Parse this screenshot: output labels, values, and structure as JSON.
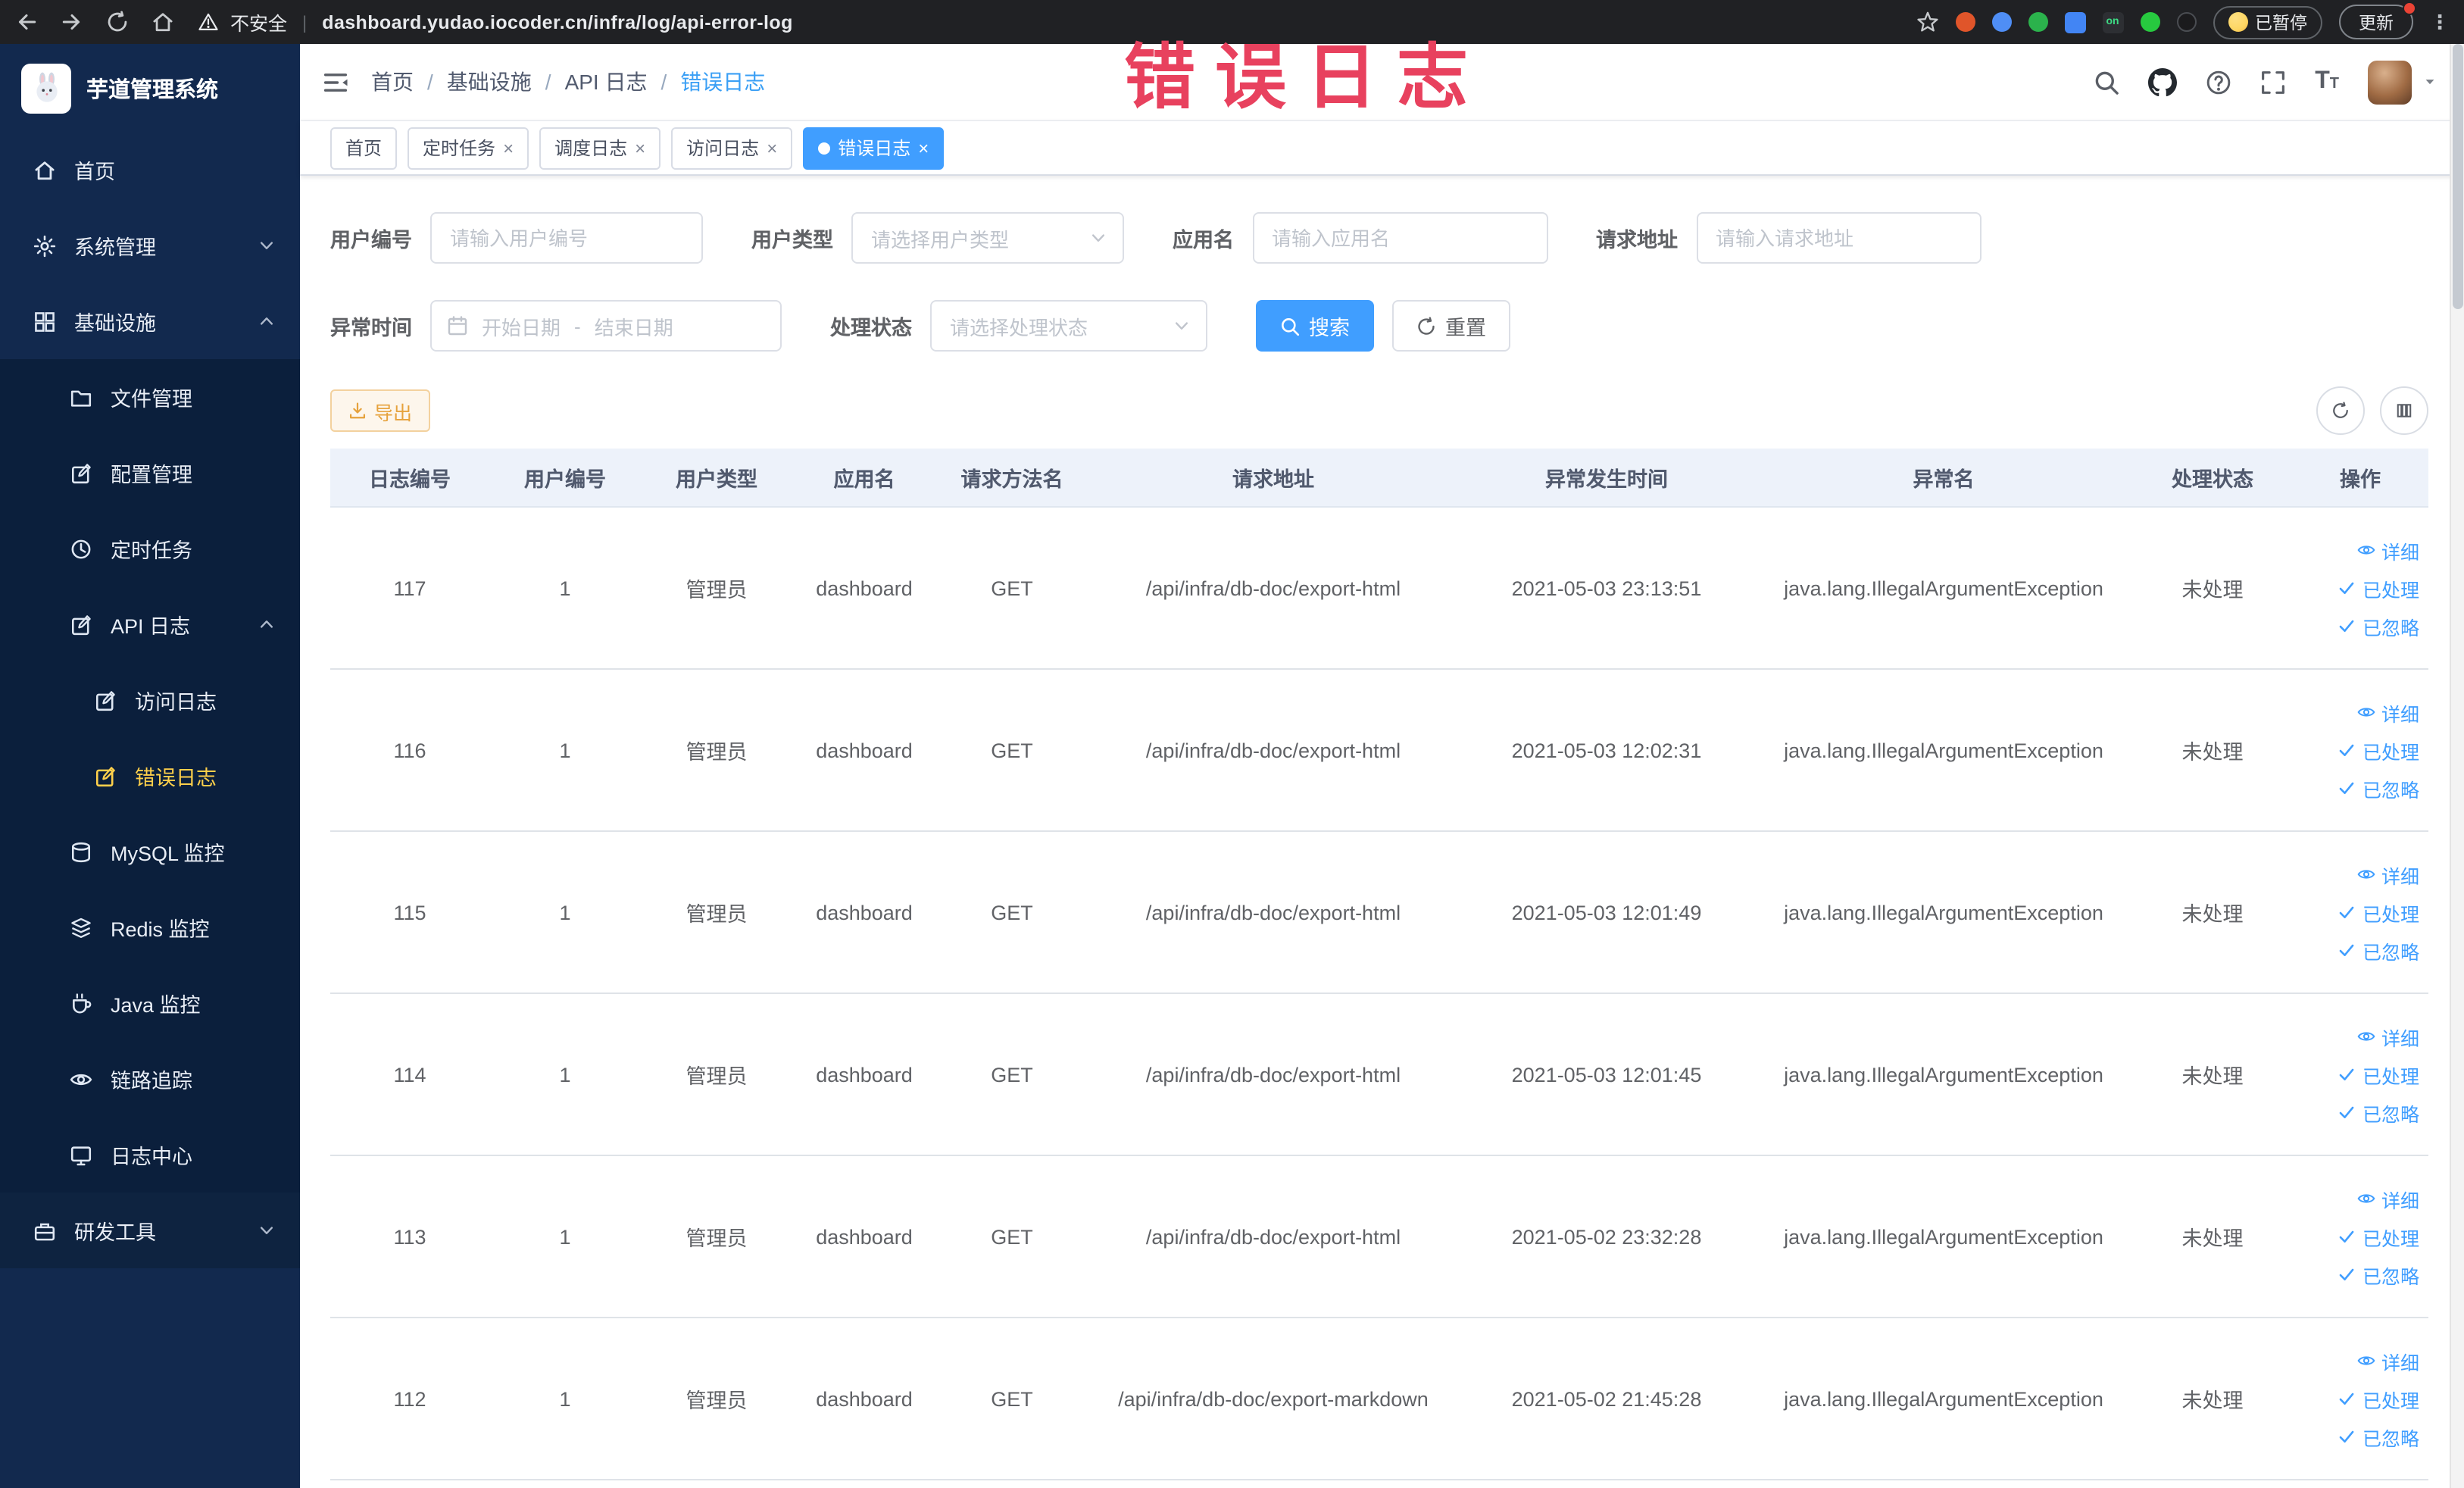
{
  "colors": {
    "accent": "#409eff",
    "warning": "#e6a23c",
    "sidebar_bg": "#12294e",
    "submenu_bg": "#0b1f3c",
    "active_menu_text": "#ffd04b",
    "annotation_red": "#e8415e",
    "table_header_bg": "#edf2fa"
  },
  "icons": {
    "back": "arrow-left",
    "forward": "arrow-right",
    "reload": "circular-arrow",
    "home": "house",
    "warning": "triangle-exclamation",
    "star": "star-outline",
    "search": "magnifier",
    "github": "octocat",
    "help": "question-circle",
    "fullscreen": "corner-brackets",
    "font-size": "T-large-small",
    "calendar": "calendar",
    "download": "arrow-into-tray",
    "refresh": "circular-arrow",
    "columns": "vertical-bars",
    "eye": "eye",
    "check": "checkmark"
  },
  "annotation": {
    "text": "错误日志"
  },
  "browser": {
    "security_text": "不安全",
    "url": "dashboard.yudao.iocoder.cn/infra/log/api-error-log",
    "paused_badge": "已暂停",
    "update_button": "更新"
  },
  "header": {
    "breadcrumb": [
      {
        "label": "首页"
      },
      {
        "label": "基础设施"
      },
      {
        "label": "API 日志"
      },
      {
        "label": "错误日志"
      }
    ]
  },
  "sidebar": {
    "title": "芋道管理系统",
    "items": [
      {
        "label": "首页"
      },
      {
        "label": "系统管理"
      },
      {
        "label": "基础设施"
      },
      {
        "label": "文件管理"
      },
      {
        "label": "配置管理"
      },
      {
        "label": "定时任务"
      },
      {
        "label": "API 日志"
      },
      {
        "label": "访问日志"
      },
      {
        "label": "错误日志"
      },
      {
        "label": "MySQL 监控"
      },
      {
        "label": "Redis 监控"
      },
      {
        "label": "Java 监控"
      },
      {
        "label": "链路追踪"
      },
      {
        "label": "日志中心"
      },
      {
        "label": "研发工具"
      }
    ]
  },
  "tags": [
    {
      "label": "首页"
    },
    {
      "label": "定时任务"
    },
    {
      "label": "调度日志"
    },
    {
      "label": "访问日志"
    },
    {
      "label": "错误日志"
    }
  ],
  "filters": {
    "user_id_label": "用户编号",
    "user_id_placeholder": "请输入用户编号",
    "user_type_label": "用户类型",
    "user_type_placeholder": "请选择用户类型",
    "app_name_label": "应用名",
    "app_name_placeholder": "请输入应用名",
    "request_url_label": "请求地址",
    "request_url_placeholder": "请输入请求地址",
    "exception_time_label": "异常时间",
    "start_date_placeholder": "开始日期",
    "range_separator": "-",
    "end_date_placeholder": "结束日期",
    "process_status_label": "处理状态",
    "process_status_placeholder": "请选择处理状态",
    "search_button": "搜索",
    "reset_button": "重置"
  },
  "toolbar": {
    "export_label": "导出"
  },
  "table": {
    "columns": [
      "日志编号",
      "用户编号",
      "用户类型",
      "应用名",
      "请求方法名",
      "请求地址",
      "异常发生时间",
      "异常名",
      "处理状态",
      "操作"
    ],
    "actions": {
      "detail": "详细",
      "processed": "已处理",
      "ignored": "已忽略"
    },
    "rows": [
      {
        "id": "117",
        "user_id": "1",
        "user_type": "管理员",
        "app": "dashboard",
        "method": "GET",
        "url": "/api/infra/db-doc/export-html",
        "time": "2021-05-03 23:13:51",
        "exception": "java.lang.IllegalArgumentException",
        "status": "未处理"
      },
      {
        "id": "116",
        "user_id": "1",
        "user_type": "管理员",
        "app": "dashboard",
        "method": "GET",
        "url": "/api/infra/db-doc/export-html",
        "time": "2021-05-03 12:02:31",
        "exception": "java.lang.IllegalArgumentException",
        "status": "未处理"
      },
      {
        "id": "115",
        "user_id": "1",
        "user_type": "管理员",
        "app": "dashboard",
        "method": "GET",
        "url": "/api/infra/db-doc/export-html",
        "time": "2021-05-03 12:01:49",
        "exception": "java.lang.IllegalArgumentException",
        "status": "未处理"
      },
      {
        "id": "114",
        "user_id": "1",
        "user_type": "管理员",
        "app": "dashboard",
        "method": "GET",
        "url": "/api/infra/db-doc/export-html",
        "time": "2021-05-03 12:01:45",
        "exception": "java.lang.IllegalArgumentException",
        "status": "未处理"
      },
      {
        "id": "113",
        "user_id": "1",
        "user_type": "管理员",
        "app": "dashboard",
        "method": "GET",
        "url": "/api/infra/db-doc/export-html",
        "time": "2021-05-02 23:32:28",
        "exception": "java.lang.IllegalArgumentException",
        "status": "未处理"
      },
      {
        "id": "112",
        "user_id": "1",
        "user_type": "管理员",
        "app": "dashboard",
        "method": "GET",
        "url": "/api/infra/db-doc/export-markdown",
        "time": "2021-05-02 21:45:28",
        "exception": "java.lang.IllegalArgumentException",
        "status": "未处理"
      }
    ]
  }
}
